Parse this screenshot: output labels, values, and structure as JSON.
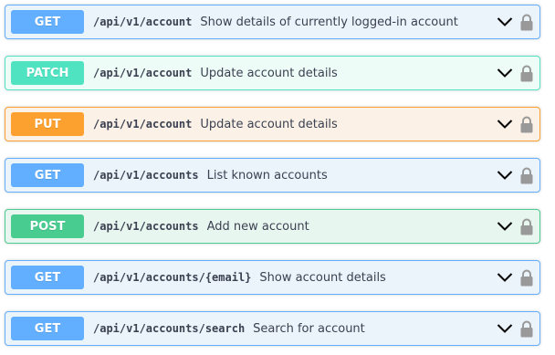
{
  "operations": [
    {
      "method": "GET",
      "path": "/api/v1/account",
      "summary": "Show details of currently logged-in account",
      "expand_icon": "chevron-down-icon",
      "auth_icon": "lock-icon"
    },
    {
      "method": "PATCH",
      "path": "/api/v1/account",
      "summary": "Update account details",
      "expand_icon": "chevron-down-icon",
      "auth_icon": "lock-icon"
    },
    {
      "method": "PUT",
      "path": "/api/v1/account",
      "summary": "Update account details",
      "expand_icon": "chevron-down-icon",
      "auth_icon": "lock-icon"
    },
    {
      "method": "GET",
      "path": "/api/v1/accounts",
      "summary": "List known accounts",
      "expand_icon": "chevron-down-icon",
      "auth_icon": "lock-icon"
    },
    {
      "method": "POST",
      "path": "/api/v1/accounts",
      "summary": "Add new account",
      "expand_icon": "chevron-down-icon",
      "auth_icon": "lock-icon"
    },
    {
      "method": "GET",
      "path": "/api/v1/accounts/{email}",
      "summary": "Show account details",
      "expand_icon": "chevron-down-icon",
      "auth_icon": "lock-icon"
    },
    {
      "method": "GET",
      "path": "/api/v1/accounts/search",
      "summary": "Search for account",
      "expand_icon": "chevron-down-icon",
      "auth_icon": "lock-icon"
    }
  ],
  "colors": {
    "get": "#61affe",
    "patch": "#50e3c2",
    "put": "#fca130",
    "post": "#49cc90",
    "text": "#3b4151",
    "icon": "#999999"
  }
}
